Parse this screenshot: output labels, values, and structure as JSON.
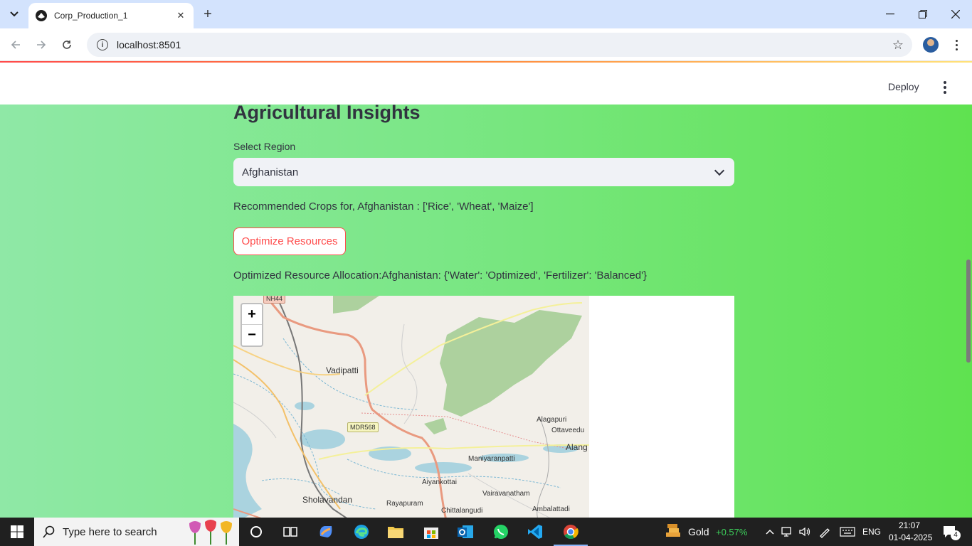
{
  "browser": {
    "tab_title": "Corp_Production_1",
    "url": "localhost:8501"
  },
  "streamlit": {
    "deploy_label": "Deploy"
  },
  "page": {
    "title": "Agricultural Insights",
    "region_label": "Select Region",
    "region_value": "Afghanistan",
    "recommendation_text": "Recommended Crops for, Afghanistan : ['Rice', 'Wheat', 'Maize']",
    "optimize_button": "Optimize Resources",
    "allocation_text": "Optimized Resource Allocation:Afghanistan: {'Water': 'Optimized', 'Fertilizer': 'Balanced'}"
  },
  "map": {
    "zoom_in": "+",
    "zoom_out": "−",
    "labels": {
      "nh44": "NH44",
      "vadipatti": "Vadipatti",
      "mdr568": "MDR568",
      "alagapuri": "Alagapuri",
      "ottaveedu": "Ottaveedu",
      "alang": "Alang",
      "maniyaranpatti": "Maniyaranpatti",
      "aiyankottai": "Aiyankottai",
      "vairavanatham": "Vairavanatham",
      "sholavandan": "Sholavandan",
      "rayapuram": "Rayapuram",
      "chittalangudi": "Chittalangudi",
      "ambalattadi": "Ambalattadi"
    }
  },
  "taskbar": {
    "search_placeholder": "Type here to search",
    "widget_label": "Gold",
    "widget_change": "+0.57%",
    "language": "ENG",
    "time": "21:07",
    "date": "01-04-2025",
    "notification_count": "4"
  },
  "colors": {
    "accent": "#ff4b4b",
    "widget_up": "#3ccf5a"
  }
}
